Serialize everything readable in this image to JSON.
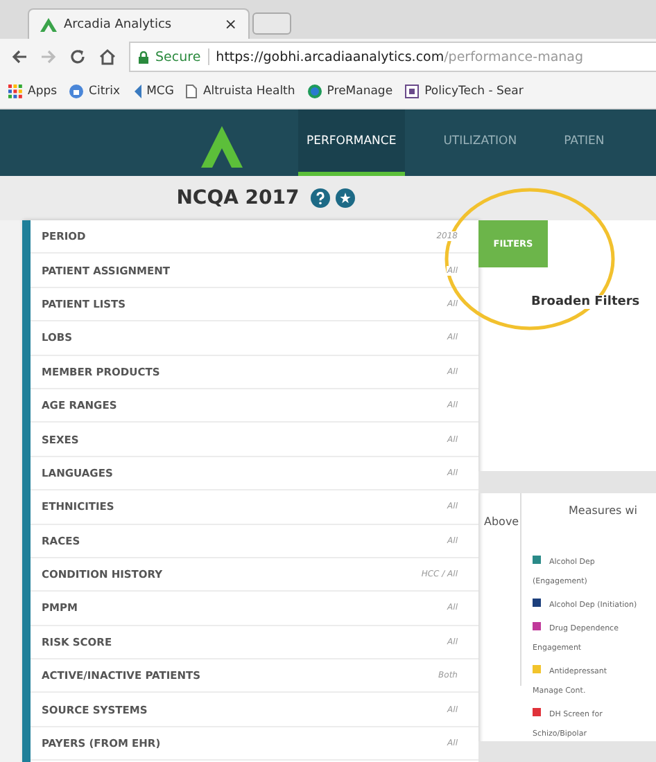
{
  "browser": {
    "tab_title": "Arcadia Analytics",
    "tab_close": "×",
    "secure_label": "Secure",
    "url_host": "https://gobhi.arcadiaanalytics.com",
    "url_path": "/performance-manag",
    "bookmarks": [
      {
        "kind": "apps",
        "label": "Apps"
      },
      {
        "kind": "citrix",
        "label": "Citrix"
      },
      {
        "kind": "mcg",
        "label": "MCG"
      },
      {
        "kind": "page",
        "label": "Altruista Health"
      },
      {
        "kind": "premanage",
        "label": "PreManage"
      },
      {
        "kind": "policytech",
        "label": "PolicyTech - Sear"
      }
    ]
  },
  "nav": {
    "tabs": [
      {
        "label": "PERFORMANCE",
        "selected": true
      },
      {
        "label": "UTILIZATION",
        "selected": false
      },
      {
        "label": "PATIEN",
        "selected": false
      }
    ]
  },
  "header": {
    "title": "NCQA 2017"
  },
  "filters": [
    {
      "label": "PERIOD",
      "value": "2018"
    },
    {
      "label": "PATIENT ASSIGNMENT",
      "value": "All"
    },
    {
      "label": "PATIENT LISTS",
      "value": "All"
    },
    {
      "label": "LOBS",
      "value": "All"
    },
    {
      "label": "MEMBER PRODUCTS",
      "value": "All"
    },
    {
      "label": "AGE RANGES",
      "value": "All"
    },
    {
      "label": "SEXES",
      "value": "All"
    },
    {
      "label": "LANGUAGES",
      "value": "All"
    },
    {
      "label": "ETHNICITIES",
      "value": "All"
    },
    {
      "label": "RACES",
      "value": "All"
    },
    {
      "label": "CONDITION HISTORY",
      "value": "HCC / All"
    },
    {
      "label": "PMPM",
      "value": "All"
    },
    {
      "label": "RISK SCORE",
      "value": "All"
    },
    {
      "label": "ACTIVE/INACTIVE PATIENTS",
      "value": "Both"
    },
    {
      "label": "SOURCE SYSTEMS",
      "value": "All"
    },
    {
      "label": "PAYERS (FROM EHR)",
      "value": "All"
    }
  ],
  "filters_button": "FILTERS",
  "message": "Broaden Filters",
  "table": {
    "column_1": "Above",
    "column_2": "Measures wi"
  },
  "legend": [
    {
      "label": "Alcohol Dep (Engagement)",
      "color": "#2a8a88"
    },
    {
      "label": "Alcohol Dep (Initiation)",
      "color": "#1c3f7c"
    },
    {
      "label": "Drug Dependence Engagement",
      "color": "#c0399a"
    },
    {
      "label": "Antidepressant Manage Cont.",
      "color": "#f2c42c"
    },
    {
      "label": "DH Screen for Schizo/Bipolar",
      "color": "#e0323a"
    }
  ]
}
